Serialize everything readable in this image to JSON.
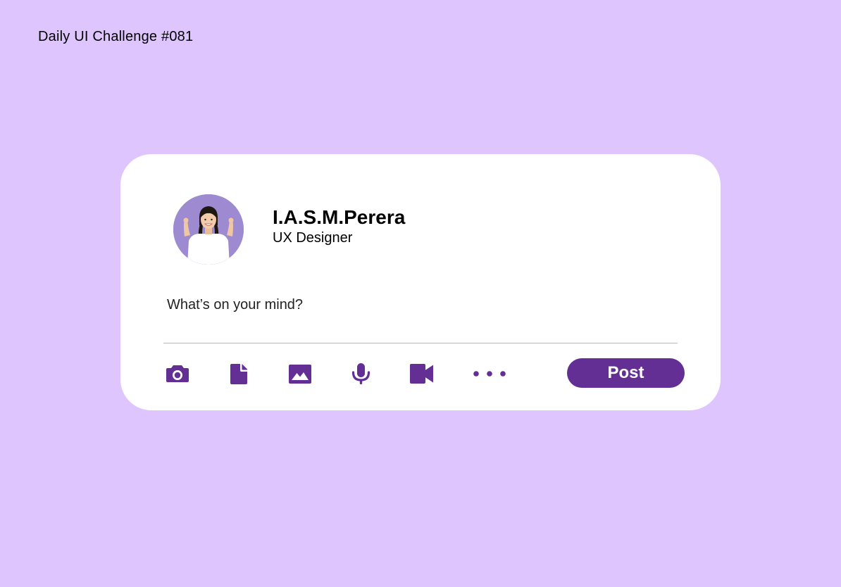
{
  "page": {
    "title": "Daily UI Challenge #081"
  },
  "composer": {
    "user": {
      "name": "I.A.S.M.Perera",
      "role": "UX Designer"
    },
    "input": {
      "placeholder": "What’s on your mind?",
      "value": ""
    },
    "tools": [
      {
        "icon": "camera-icon"
      },
      {
        "icon": "document-icon"
      },
      {
        "icon": "image-icon"
      },
      {
        "icon": "microphone-icon"
      },
      {
        "icon": "video-camera-icon"
      },
      {
        "icon": "more-options-icon"
      }
    ],
    "post_label": "Post"
  },
  "colors": {
    "background": "#dfc5fe",
    "card": "#ffffff",
    "accent": "#642f95",
    "divider": "#b8b8b8"
  }
}
